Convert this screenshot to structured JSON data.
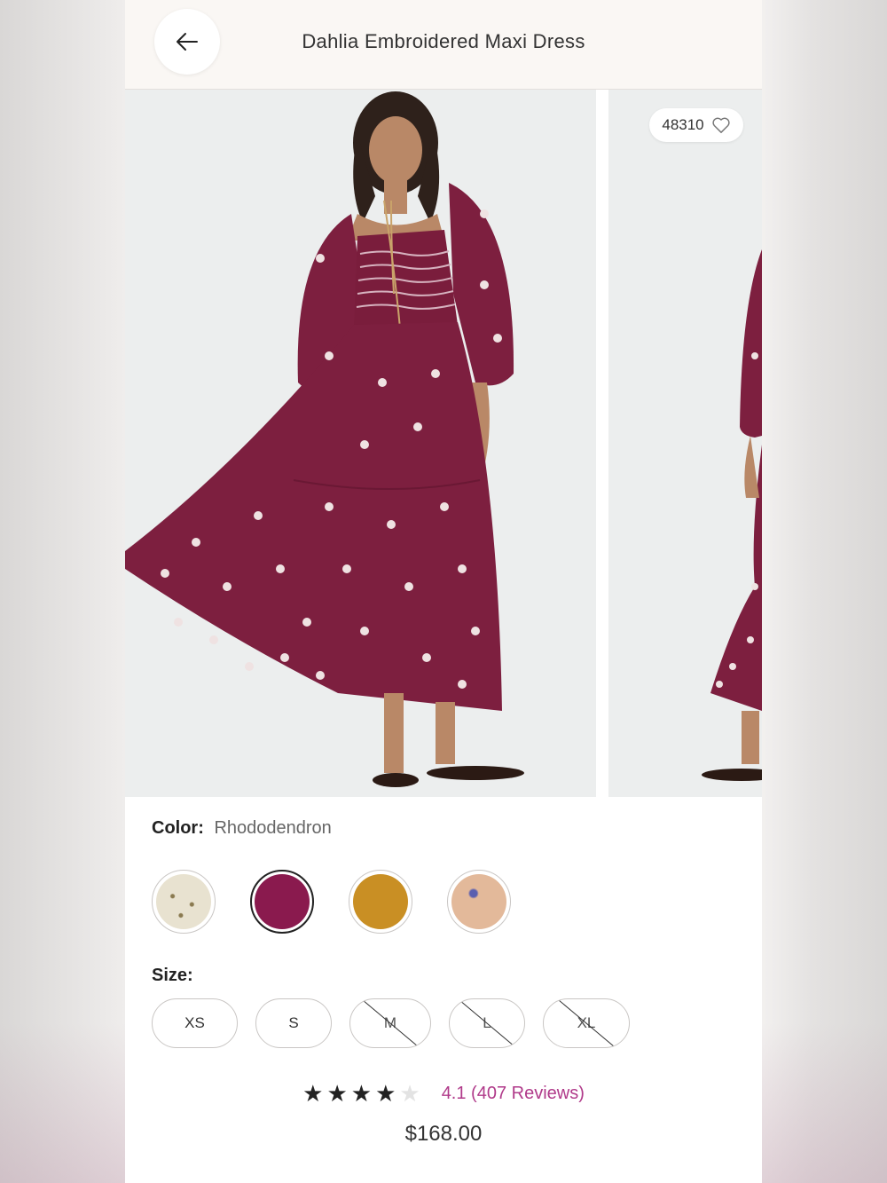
{
  "header": {
    "title": "Dahlia Embroidered Maxi Dress",
    "back_icon": "arrow-left-icon"
  },
  "gallery": {
    "favorites_count": "48310",
    "favorite_icon": "heart-outline-icon"
  },
  "color": {
    "label": "Color:",
    "selected": "Rhododendron",
    "swatches": [
      {
        "name": "cream-dot",
        "color": "#e8e2d0",
        "selected": false
      },
      {
        "name": "rhododendron",
        "color": "#8a1a4e",
        "selected": true
      },
      {
        "name": "mustard",
        "color": "#c98f24",
        "selected": false
      },
      {
        "name": "peach-floral",
        "color": "#e3b99a",
        "selected": false
      }
    ]
  },
  "size": {
    "label": "Size:",
    "options": [
      {
        "label": "XS",
        "available": true
      },
      {
        "label": "S",
        "available": true
      },
      {
        "label": "M",
        "available": false
      },
      {
        "label": "L",
        "available": false
      },
      {
        "label": "XL",
        "available": false
      }
    ]
  },
  "rating": {
    "value": 4.1,
    "stars_filled": 4,
    "stars_total": 5,
    "text": "4.1 (407 Reviews)"
  },
  "price": "$168.00",
  "colors": {
    "accent": "#b03a8a",
    "header_bg": "#faf7f4",
    "dress": "#7d1f3f"
  }
}
